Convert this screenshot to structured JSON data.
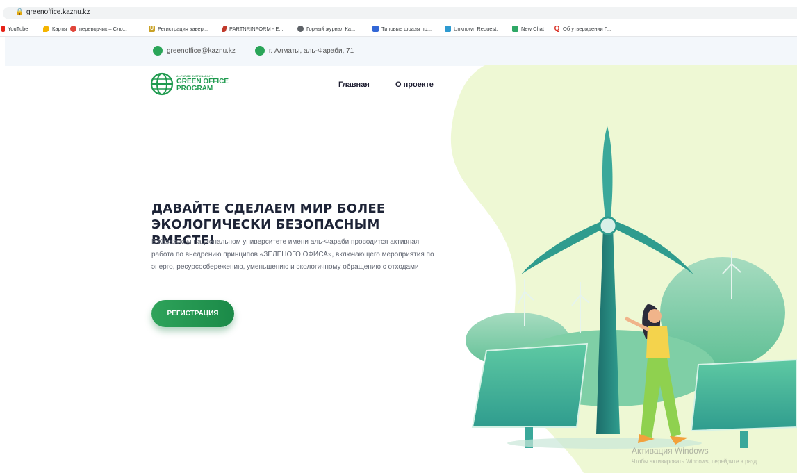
{
  "browser": {
    "url": "greenoffice.kaznu.kz",
    "bookmarks": [
      {
        "label": "YouTube",
        "icon": "youtube-icon",
        "color": "#e62117"
      },
      {
        "label": "Карты",
        "icon": "maps-pin-icon",
        "color": "#f4b400"
      },
      {
        "label": "переводчик – Сло...",
        "icon": "translator-icon",
        "color": "#e0453a"
      },
      {
        "label": "Регистрация завер...",
        "icon": "u-icon",
        "color": "#c9a227"
      },
      {
        "label": "PARTNRINFORM - E...",
        "icon": "partnrinform-icon",
        "color": "#c0392b"
      },
      {
        "label": "Горный журнал Ка...",
        "icon": "globe-icon",
        "color": "#5f6368"
      },
      {
        "label": "Типовые фразы пр...",
        "icon": "doc-icon",
        "color": "#3367d6"
      },
      {
        "label": "Unknown Request.",
        "icon": "grid-icon",
        "color": "#2e9ad0"
      },
      {
        "label": "New Chat",
        "icon": "chat-icon",
        "color": "#2fa866"
      },
      {
        "label": "Об утверждении Г...",
        "icon": "search-q-icon",
        "color": "#d93025"
      }
    ]
  },
  "site": {
    "email": "greenoffice@kaznu.kz",
    "address": "г. Алматы, аль-Фараби, 71",
    "logo": {
      "small": "AL-FARABI SUSTAINABILITY",
      "line1": "GREEN OFFICE",
      "line2": "PROGRAM"
    },
    "nav": [
      "Главная",
      "О проекте"
    ],
    "hero": {
      "title": "ДАВАЙТЕ СДЕЛАЕМ МИР БОЛЕЕ ЭКОЛОГИЧЕСКИ БЕЗОПАСНЫМ ВМЕСТЕ!",
      "text": "В Казахском национальном университете имени аль-Фараби проводится активная работа по внедрению принципов «ЗЕЛЕНОГО ОФИСА», включающего мероприятия по энерго, ресурсосбережению, уменьшению и экологичному обращению с отходами",
      "button": "РЕГИСТРАЦИЯ"
    },
    "colors": {
      "accent": "#1e9a4e",
      "blob": "#eef8d4"
    }
  },
  "overlay": {
    "line1": "Активация Windows",
    "line2": "Чтобы активировать Windows, перейдите в разд"
  }
}
